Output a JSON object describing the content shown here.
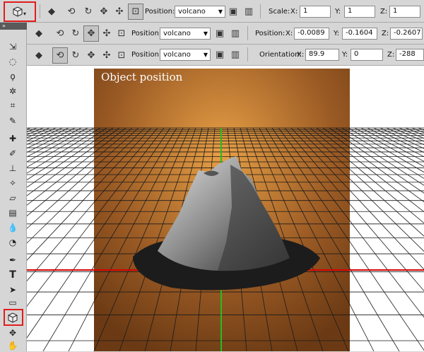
{
  "options_bar": {
    "row1": {
      "position_label": "Position:",
      "preset": "volcano",
      "scale_label": "Scale:",
      "x_label": "X:",
      "x": "1",
      "y_label": "Y:",
      "y": "1",
      "z_label": "Z:",
      "z": "1"
    },
    "row2": {
      "position_label": "Position:",
      "preset": "volcano",
      "values_label": "Position:",
      "x_label": "X:",
      "x": "-0.0089",
      "y_label": "Y:",
      "y": "-0.1604",
      "z_label": "Z:",
      "z": "-0.2607"
    },
    "row3": {
      "position_label": "Position:",
      "preset": "volcano",
      "values_label": "Orientation:",
      "x_label": "X:",
      "x": "89.9",
      "y_label": "Y:",
      "y": "0",
      "z_label": "Z:",
      "z": "-288"
    }
  },
  "sidebar": {
    "collapse_glyph": "»"
  },
  "canvas": {
    "title": "Object position"
  },
  "colors": {
    "highlight": "#e21d1d",
    "axis_x": "#d40000",
    "axis_y": "#20c020",
    "backdrop_center": "#e8a046",
    "backdrop_edge": "#6b3a14"
  },
  "icons": [
    "3d-rotate-icon",
    "3d-roll-icon",
    "3d-drag-icon",
    "3d-slide-icon",
    "3d-scale-icon",
    "3d-cube-icon",
    "save-icon",
    "trash-icon",
    "move-tool-icon",
    "marquee-tool-icon",
    "lasso-tool-icon",
    "magic-wand-icon",
    "crop-tool-icon",
    "eyedropper-icon",
    "healing-brush-icon",
    "brush-icon",
    "clone-stamp-icon",
    "history-brush-icon",
    "eraser-icon",
    "gradient-icon",
    "blur-icon",
    "dodge-icon",
    "pen-tool-icon",
    "type-tool-icon",
    "path-select-icon",
    "shape-tool-icon",
    "3d-object-tool-icon",
    "3d-camera-tool-icon",
    "hand-tool-icon"
  ]
}
